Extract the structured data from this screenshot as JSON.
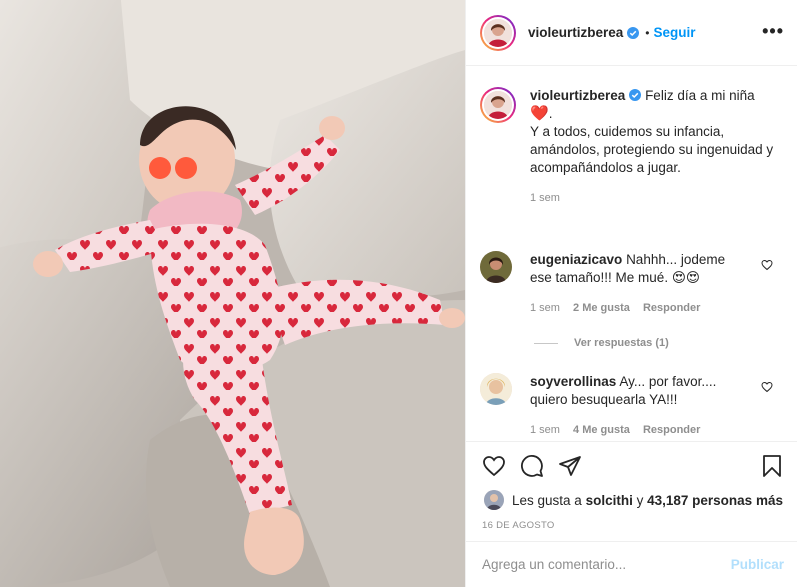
{
  "header": {
    "username": "violeurtizberea",
    "separator": "•",
    "follow_label": "Seguir",
    "more_icon": "more-dots-icon"
  },
  "caption": {
    "username": "violeurtizberea",
    "line1": "Feliz día a mi niña",
    "heart": "❤️",
    "line2": "Y a todos, cuidemos su infancia, amándolos, protegiendo su ingenuidad y acompañándolos a jugar.",
    "time": "1 sem"
  },
  "comments": [
    {
      "username": "eugeniazicavo",
      "text": "Nahhh... jodeme ese tamaño!!! Me mué. 😍😍",
      "time": "1 sem",
      "likes": "2 Me gusta",
      "reply": "Responder",
      "view_replies": "Ver respuestas (1)"
    },
    {
      "username": "soyverollinas",
      "text": "Ay... por favor.... quiero besuquearla YA!!!",
      "time": "1 sem",
      "likes": "4 Me gusta",
      "reply": "Responder"
    }
  ],
  "actions": {
    "icons": [
      "heart-icon",
      "comment-icon",
      "share-icon",
      "bookmark-icon"
    ]
  },
  "likes": {
    "prefix": "Les gusta a",
    "user": "solcithi",
    "conj": "y",
    "count": "43,187 personas más"
  },
  "date": "16 DE AGOSTO",
  "add_comment": {
    "placeholder": "Agrega un comentario...",
    "publish_label": "Publicar"
  },
  "colors": {
    "link_blue": "#0095f6",
    "publish_disabled": "#b2dffc",
    "muted": "#8e8e8e",
    "pajama_red": "#d8283c"
  }
}
